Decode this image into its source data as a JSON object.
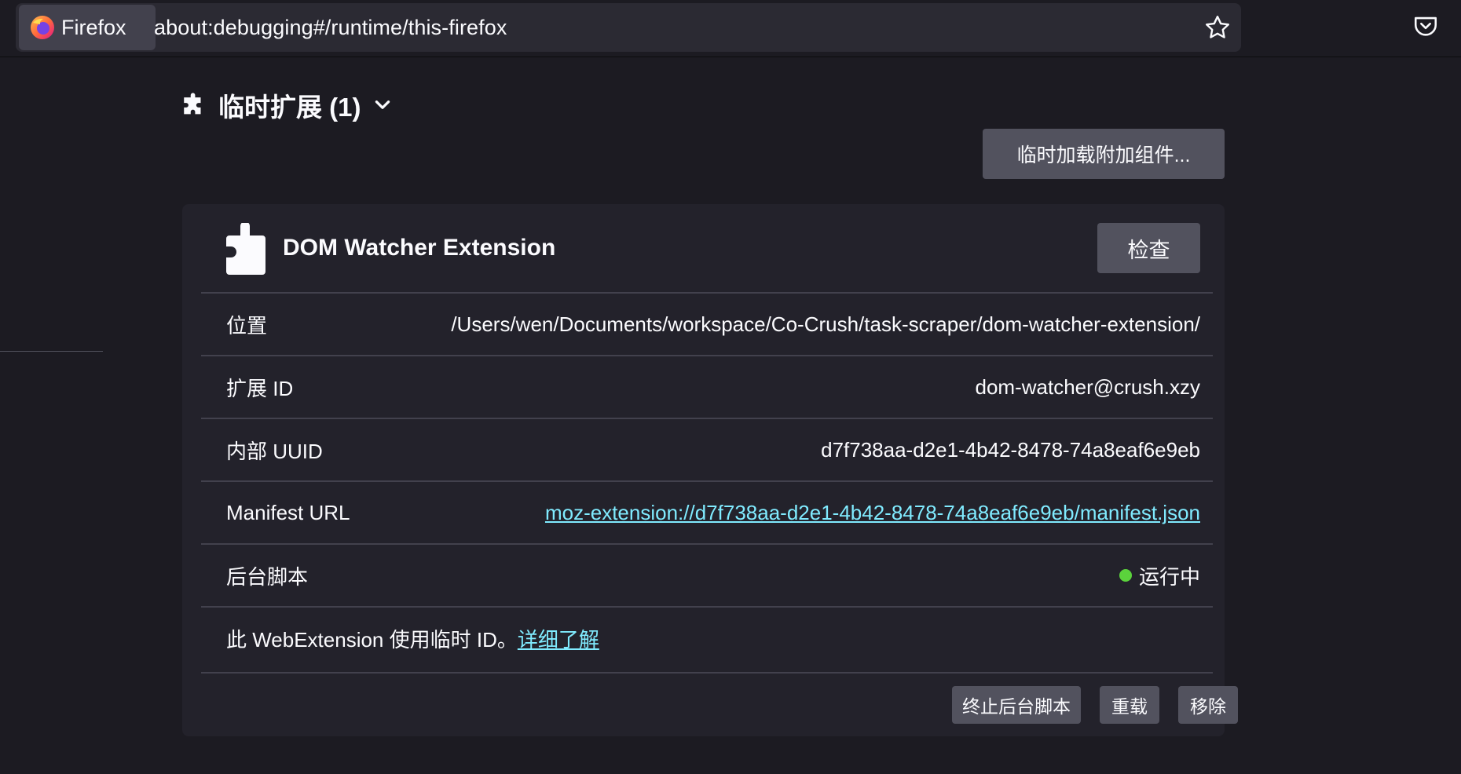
{
  "urlbar": {
    "identity_label": "Firefox",
    "url": "about:debugging#/runtime/this-firefox",
    "star_icon": "star-icon",
    "pocket_icon": "pocket-icon"
  },
  "section": {
    "title": "临时扩展 (1)",
    "icon": "puzzle-icon",
    "toggle_icon": "chevron-down-icon",
    "load_button": "临时加载附加组件..."
  },
  "extension": {
    "name": "DOM Watcher Extension",
    "inspect_button": "检查",
    "rows": {
      "location": {
        "label": "位置",
        "value": "/Users/wen/Documents/workspace/Co-Crush/task-scraper/dom-watcher-extension/"
      },
      "ext_id": {
        "label": "扩展 ID",
        "value": "dom-watcher@crush.xzy"
      },
      "uuid": {
        "label": "内部 UUID",
        "value": "d7f738aa-d2e1-4b42-8478-74a8eaf6e9eb"
      },
      "manifest": {
        "label": "Manifest URL",
        "value": "moz-extension://d7f738aa-d2e1-4b42-8478-74a8eaf6e9eb/manifest.json"
      },
      "background": {
        "label": "后台脚本",
        "value": "运行中",
        "status_color": "#5bd33c"
      }
    },
    "note": {
      "text": "此 WebExtension 使用临时 ID。",
      "link": "详细了解"
    },
    "buttons": {
      "stop": "终止后台脚本",
      "reload": "重载",
      "remove": "移除"
    }
  },
  "colors": {
    "background": "#1c1b22",
    "card": "#23222b",
    "button": "#52525e",
    "link": "#80ebff"
  }
}
